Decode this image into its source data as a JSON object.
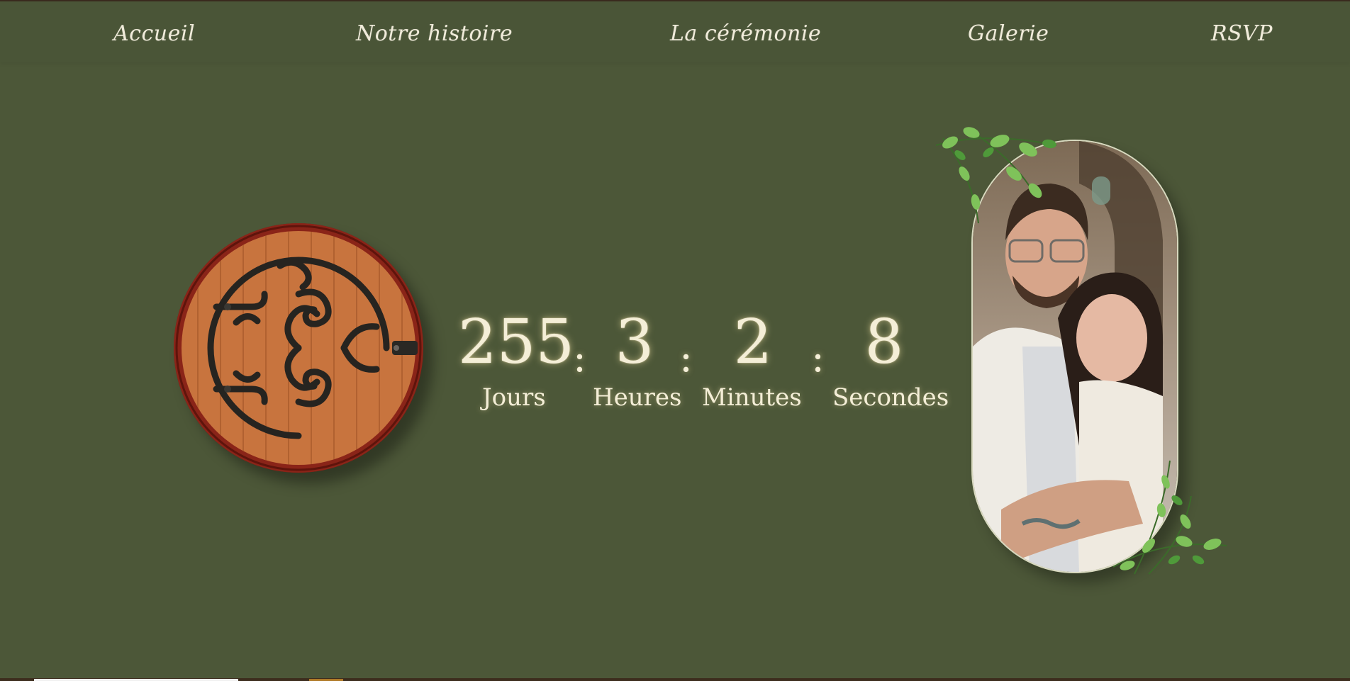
{
  "nav": {
    "items": [
      {
        "label": "Accueil"
      },
      {
        "label": "Notre histoire"
      },
      {
        "label": "La cérémonie"
      },
      {
        "label": "Galerie"
      },
      {
        "label": "RSVP"
      }
    ]
  },
  "countdown": {
    "days": "255",
    "hours": "3",
    "minutes": "2",
    "seconds": "8",
    "separator": ":",
    "labels": {
      "days": "Jours",
      "hours": "Heures",
      "minutes": "Minutes",
      "seconds": "Secondes"
    }
  },
  "colors": {
    "background": "#4c5738",
    "text": "#f4eed7",
    "door": "#c8743e"
  },
  "icons": {
    "door": "hobbit-door-icon",
    "leaves": "leaf-branch-icon"
  }
}
